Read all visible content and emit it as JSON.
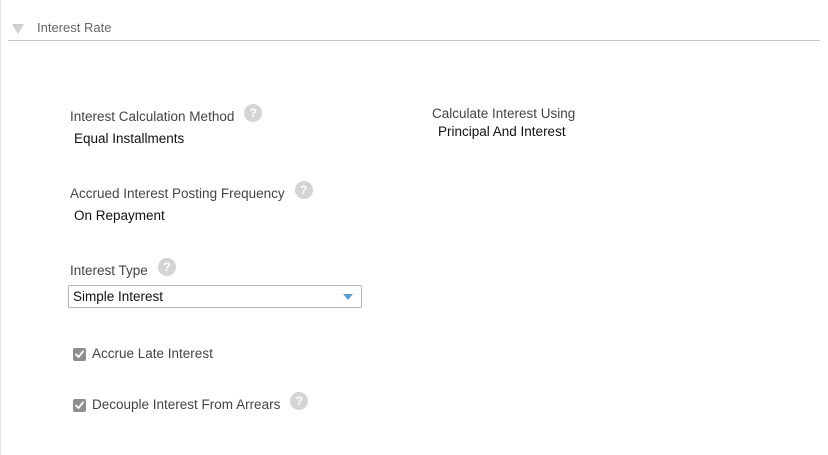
{
  "section": {
    "title": "Interest Rate",
    "toggle_icon": "triangle-down-icon"
  },
  "fields": {
    "interest_calculation_method": {
      "label": "Interest Calculation Method",
      "value": "Equal Installments"
    },
    "calculate_interest_using": {
      "label": "Calculate Interest Using",
      "value": "Principal And Interest"
    },
    "accrued_interest_posting_frequency": {
      "label": "Accrued Interest Posting Frequency",
      "value": "On Repayment"
    },
    "interest_type": {
      "label": "Interest Type",
      "selected": "Simple Interest"
    }
  },
  "checkboxes": {
    "accrue_late_interest": {
      "label": "Accrue Late Interest",
      "checked": true
    },
    "decouple_interest_from_arrears": {
      "label": "Decouple Interest From Arrears",
      "checked": true
    }
  },
  "icons": {
    "help": "help-icon",
    "help_glyph": "?",
    "select_arrow": "chevron-down-icon"
  },
  "colors": {
    "select_arrow": "#5a9fd0",
    "checkbox_fill": "#8e8e8e",
    "help_icon": "#d4d4d4"
  }
}
